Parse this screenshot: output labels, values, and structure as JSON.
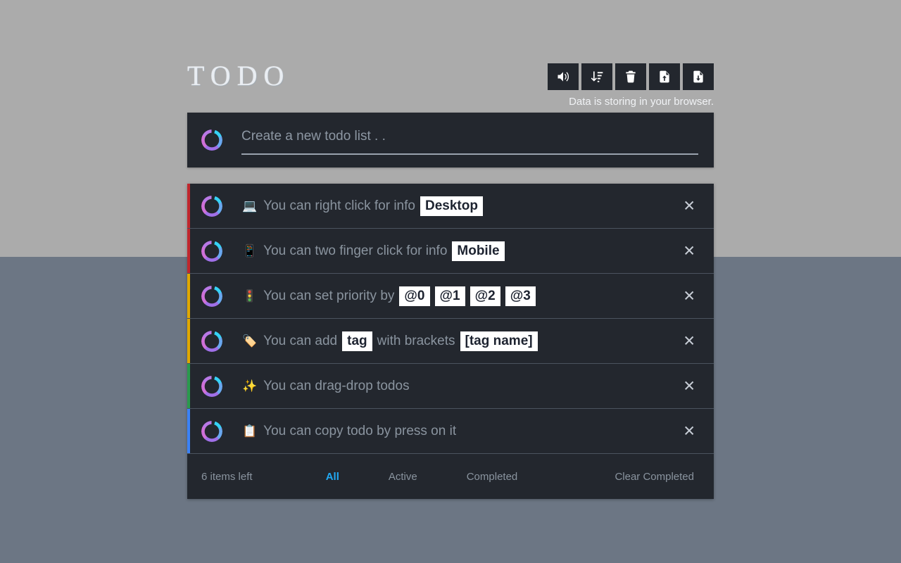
{
  "app": {
    "title": "TODO",
    "storage_note": "Data is storing in your browser.",
    "background_top": "#ababab",
    "background_bottom": "#6c7684",
    "card_bg": "#23272e"
  },
  "toolbar": {
    "buttons": [
      {
        "name": "volume-up-icon",
        "label": "Sound"
      },
      {
        "name": "sort-amount-down-icon",
        "label": "Sort"
      },
      {
        "name": "trash-icon",
        "label": "Delete All"
      },
      {
        "name": "file-upload-icon",
        "label": "Import"
      },
      {
        "name": "file-download-icon",
        "label": "Export"
      }
    ]
  },
  "new_todo": {
    "placeholder": "Create a new todo list . .",
    "value": "",
    "ring_icon": "circle-ring-icon"
  },
  "todos": [
    {
      "emoji": "💻",
      "emoji_name": "laptop-emoji",
      "priority_color": "#c1272d",
      "delete_label": "✕",
      "parts": [
        {
          "type": "text",
          "value": "You can right click for info"
        },
        {
          "type": "badge",
          "value": "Desktop"
        }
      ]
    },
    {
      "emoji": "📱",
      "emoji_name": "mobile-phone-emoji",
      "priority_color": "#c1272d",
      "delete_label": "✕",
      "parts": [
        {
          "type": "text",
          "value": "You can two finger click for info"
        },
        {
          "type": "badge",
          "value": "Mobile"
        }
      ]
    },
    {
      "emoji": "🚦",
      "emoji_name": "traffic-light-emoji",
      "priority_color": "#e0a800",
      "delete_label": "✕",
      "parts": [
        {
          "type": "text",
          "value": "You can set priority by"
        },
        {
          "type": "badge",
          "value": "@0"
        },
        {
          "type": "badge",
          "value": "@1"
        },
        {
          "type": "badge",
          "value": "@2"
        },
        {
          "type": "badge",
          "value": "@3"
        }
      ]
    },
    {
      "emoji": "🏷️",
      "emoji_name": "label-tag-emoji",
      "priority_color": "#e0a800",
      "delete_label": "✕",
      "parts": [
        {
          "type": "text",
          "value": "You can add"
        },
        {
          "type": "badge",
          "value": "tag"
        },
        {
          "type": "text",
          "value": "with brackets"
        },
        {
          "type": "badge",
          "value": "[tag name]"
        }
      ]
    },
    {
      "emoji": "✨",
      "emoji_name": "sparkles-emoji",
      "priority_color": "#2a9a4d",
      "delete_label": "✕",
      "parts": [
        {
          "type": "text",
          "value": "You can drag-drop todos"
        }
      ]
    },
    {
      "emoji": "📋",
      "emoji_name": "clipboard-emoji",
      "priority_color": "#3b82f6",
      "delete_label": "✕",
      "parts": [
        {
          "type": "text",
          "value": "You can copy todo by press on it"
        }
      ]
    }
  ],
  "footer": {
    "items_left": "6 items left",
    "filters": [
      {
        "label": "All",
        "active": true
      },
      {
        "label": "Active",
        "active": false
      },
      {
        "label": "Completed",
        "active": false
      }
    ],
    "clear_completed": "Clear Completed",
    "active_color": "#21a9f3"
  }
}
